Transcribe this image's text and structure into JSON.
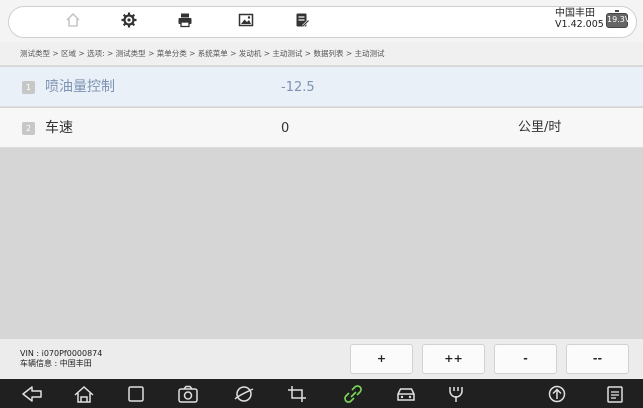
{
  "brand": {
    "name": "中国丰田",
    "version": "V1.42.005"
  },
  "battery": {
    "voltage": "19.3V"
  },
  "icons": [
    "home-icon",
    "settings-icon",
    "print-icon",
    "image-icon",
    "report-icon"
  ],
  "breadcrumb": "测试类型 > 区域 > 选项: > 测试类型 > 菜单分类 > 系统菜单 > 发动机 > 主动测试 > 数据列表 > 主动测试",
  "rows": [
    {
      "index": "1",
      "name": "喷油量控制",
      "value": "-12.5",
      "unit": ""
    },
    {
      "index": "2",
      "name": "车速",
      "value": "0",
      "unit": "公里/时"
    }
  ],
  "vehicle": {
    "vin": "VIN : i070Pf0000874",
    "info": "车辆信息 : 中国丰田"
  },
  "buttons": [
    "+",
    "++",
    "-",
    "--"
  ],
  "nav_icons": [
    "back-icon",
    "home-icon",
    "recents-icon",
    "camera-icon",
    "browser-icon",
    "crop-icon",
    "link-icon",
    "car-icon",
    "diagnostic-icon",
    "upload-icon",
    "clipboard-icon"
  ],
  "colors": {
    "active_row": "#e9f0f7",
    "active_text": "#7d93b3",
    "link_icon": "#7ed957"
  }
}
